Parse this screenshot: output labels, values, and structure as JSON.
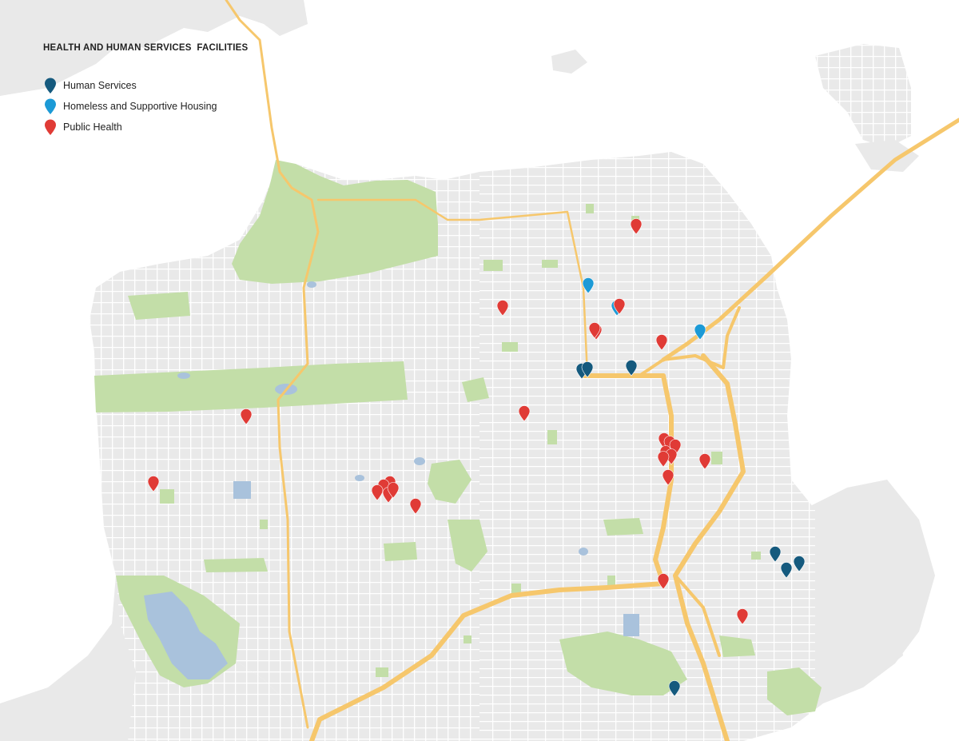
{
  "title": "HEALTH AND HUMAN SERVICES  FACILITIES",
  "legend": [
    {
      "label": "Human Services",
      "color": "#155a7e",
      "icon": "map-pin-icon"
    },
    {
      "label": "Homeless and Supportive Housing",
      "color": "#1c9ad6",
      "icon": "map-pin-icon"
    },
    {
      "label": "Public Health",
      "color": "#e03b36",
      "icon": "map-pin-icon"
    }
  ],
  "colors": {
    "land": "#e9e9e9",
    "water": "#ffffff",
    "street": "#ffffff",
    "park": "#c3dea8",
    "lake": "#a9c2dc",
    "highway": "#f6c76c"
  }
}
